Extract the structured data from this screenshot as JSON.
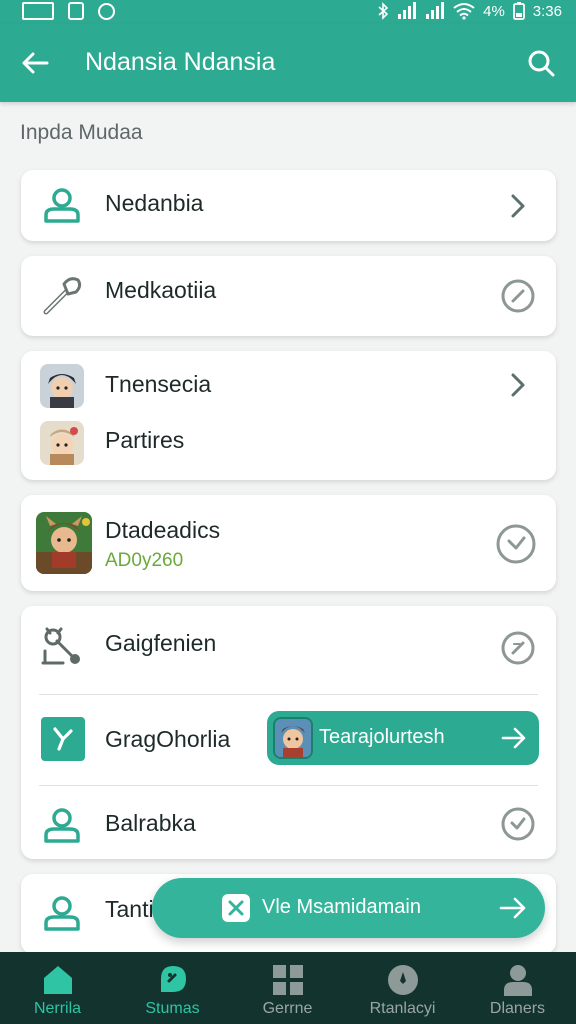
{
  "status_bar": {
    "battery_percent": "4%",
    "time": "3:36"
  },
  "app_bar": {
    "title": "Ndansia Ndansia"
  },
  "section": {
    "label": "Inpda Mudaa"
  },
  "items": [
    {
      "label": "Nedanbia",
      "icon": "person-icon",
      "trail": "chevron-right-icon"
    },
    {
      "label": "Medkaotiia",
      "icon": "wrench-icon",
      "trail": "clock-icon"
    },
    {
      "label": "Tnensecia",
      "icon": "avatar",
      "trail": "chevron-right-icon"
    },
    {
      "label": "Partires",
      "icon": "avatar"
    },
    {
      "label": "Dtadeadics",
      "sub": "AD0y260",
      "icon": "game-avatar",
      "trail": "clock-icon"
    },
    {
      "label": "Gaigfenien",
      "icon": "tool-icon",
      "trail": "clock-icon"
    },
    {
      "label": "GragOhorlia",
      "icon": "branch-icon",
      "chip_label": "Tearajolurtesh"
    },
    {
      "label": "Balrabka",
      "icon": "person-icon",
      "trail": "clock-icon"
    },
    {
      "label": "Tanti",
      "icon": "person-icon"
    }
  ],
  "fab": {
    "label": "Vle Msamidamain"
  },
  "bottom_nav": [
    {
      "label": "Nerrila",
      "icon": "home-icon",
      "active": true
    },
    {
      "label": "Stumas",
      "icon": "chat-icon",
      "active": true
    },
    {
      "label": "Gerrne",
      "icon": "grid-icon",
      "active": false
    },
    {
      "label": "Rtanlacyi",
      "icon": "compass-icon",
      "active": false
    },
    {
      "label": "Dlaners",
      "icon": "profile-icon",
      "active": false
    }
  ],
  "colors": {
    "primary": "#2daa92",
    "nav_bg": "#13332f",
    "accent_green": "#6aaa3c"
  }
}
